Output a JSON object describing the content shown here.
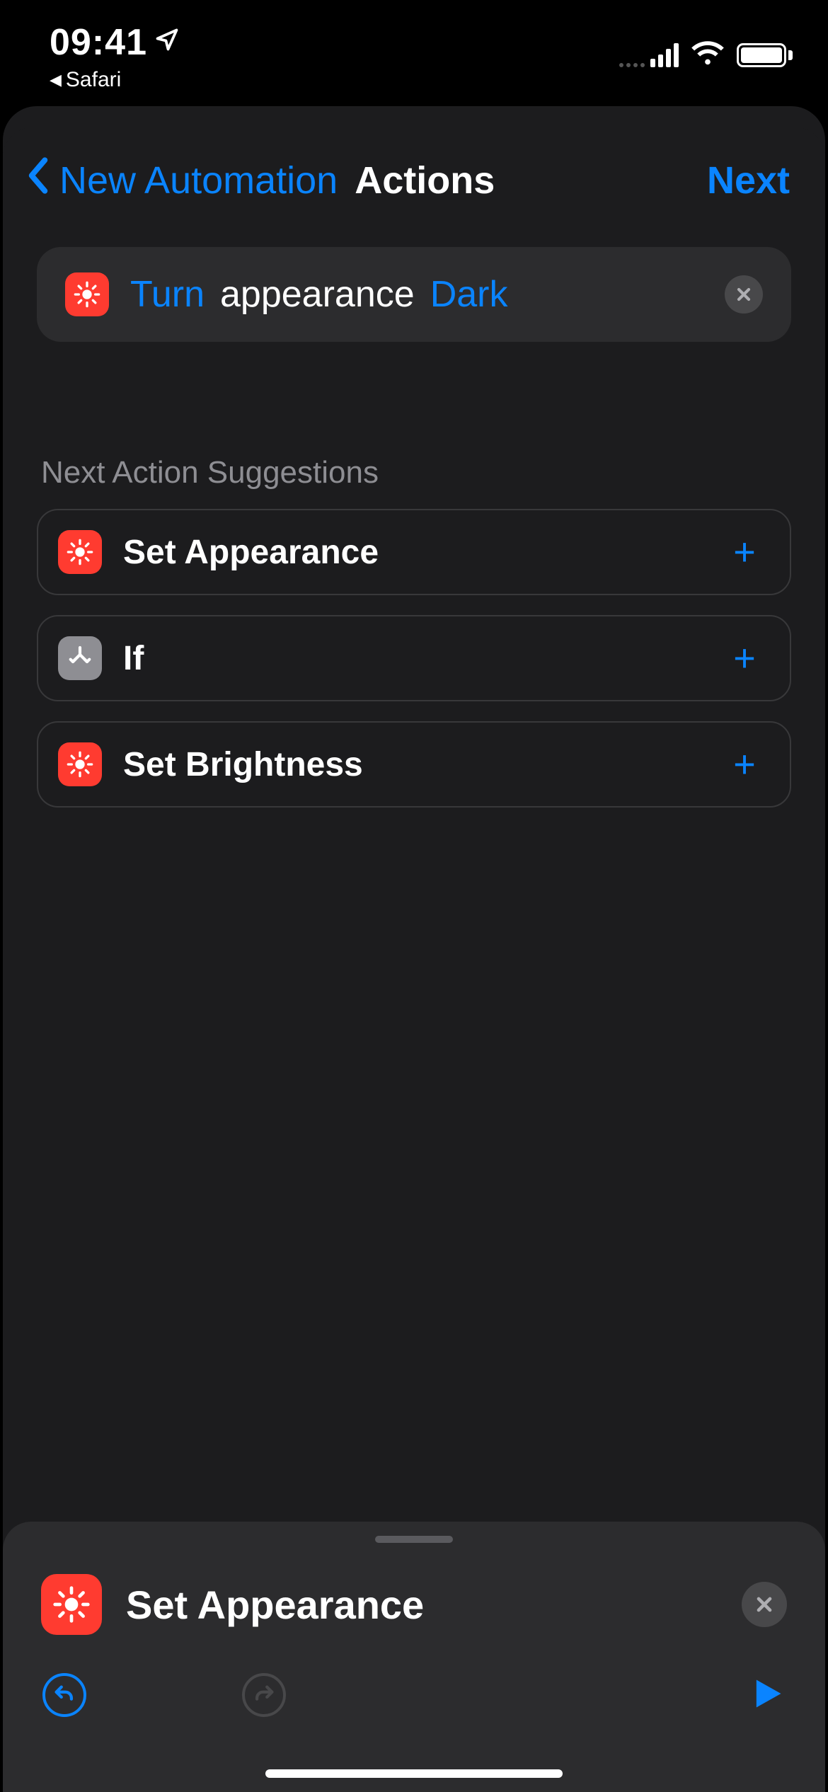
{
  "statusbar": {
    "time": "09:41",
    "back_app": "Safari"
  },
  "nav": {
    "back_label": "New Automation",
    "title": "Actions",
    "next_label": "Next"
  },
  "action": {
    "param1": "Turn",
    "word": "appearance",
    "param2": "Dark",
    "icon": "brightness-icon"
  },
  "suggestions_header": "Next Action Suggestions",
  "suggestions": [
    {
      "label": "Set Appearance",
      "icon": "brightness-icon",
      "icon_color": "red"
    },
    {
      "label": "If",
      "icon": "branch-icon",
      "icon_color": "gray"
    },
    {
      "label": "Set Brightness",
      "icon": "brightness-icon",
      "icon_color": "red"
    }
  ],
  "bottom_panel": {
    "title": "Set Appearance",
    "icon": "brightness-icon"
  }
}
